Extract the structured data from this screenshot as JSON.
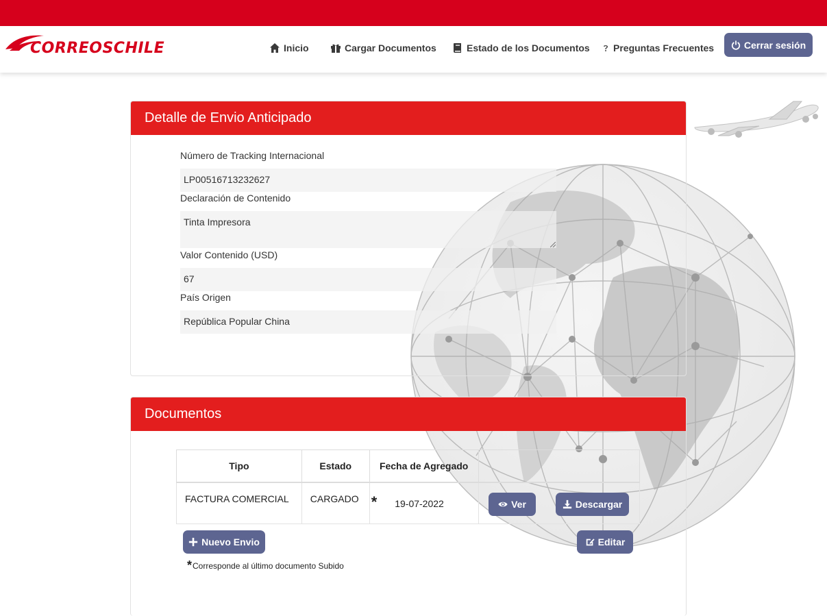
{
  "header": {
    "logo_text": "CORREOSCHILE",
    "nav": [
      {
        "label": "Inicio",
        "icon": "home-icon"
      },
      {
        "label": "Cargar Documentos",
        "icon": "gift-icon"
      },
      {
        "label": "Estado de los Documentos",
        "icon": "book-icon"
      },
      {
        "label": "Preguntas Frecuentes",
        "icon": "question-icon"
      }
    ],
    "logout_label": "Cerrar sesión"
  },
  "detail": {
    "title": "Detalle de Envio Anticipado",
    "fields": [
      {
        "label": "Número de Tracking Internacional",
        "value": "LP00516713232627"
      },
      {
        "label": "Declaración de Contenido",
        "value": "Tinta Impresora"
      },
      {
        "label": "Valor Contenido (USD)",
        "value": "67"
      },
      {
        "label": "País Origen",
        "value": "República Popular China"
      }
    ]
  },
  "documents": {
    "title": "Documentos",
    "columns": [
      "Tipo",
      "Estado",
      "Fecha de Agregado",
      ""
    ],
    "rows": [
      {
        "tipo": "FACTURA COMERCIAL",
        "estado": "CARGADO",
        "marker": "*",
        "fecha": "19-07-2022",
        "view_label": "Ver",
        "download_label": "Descargar"
      }
    ],
    "new_label": "Nuevo Envio",
    "edit_label": "Editar",
    "footnote_marker": "*",
    "footnote": "Corresponde al último documento Subido"
  },
  "colors": {
    "brand_red": "#d6001c",
    "header_red": "#e31e1e",
    "button": "#5d6591"
  }
}
